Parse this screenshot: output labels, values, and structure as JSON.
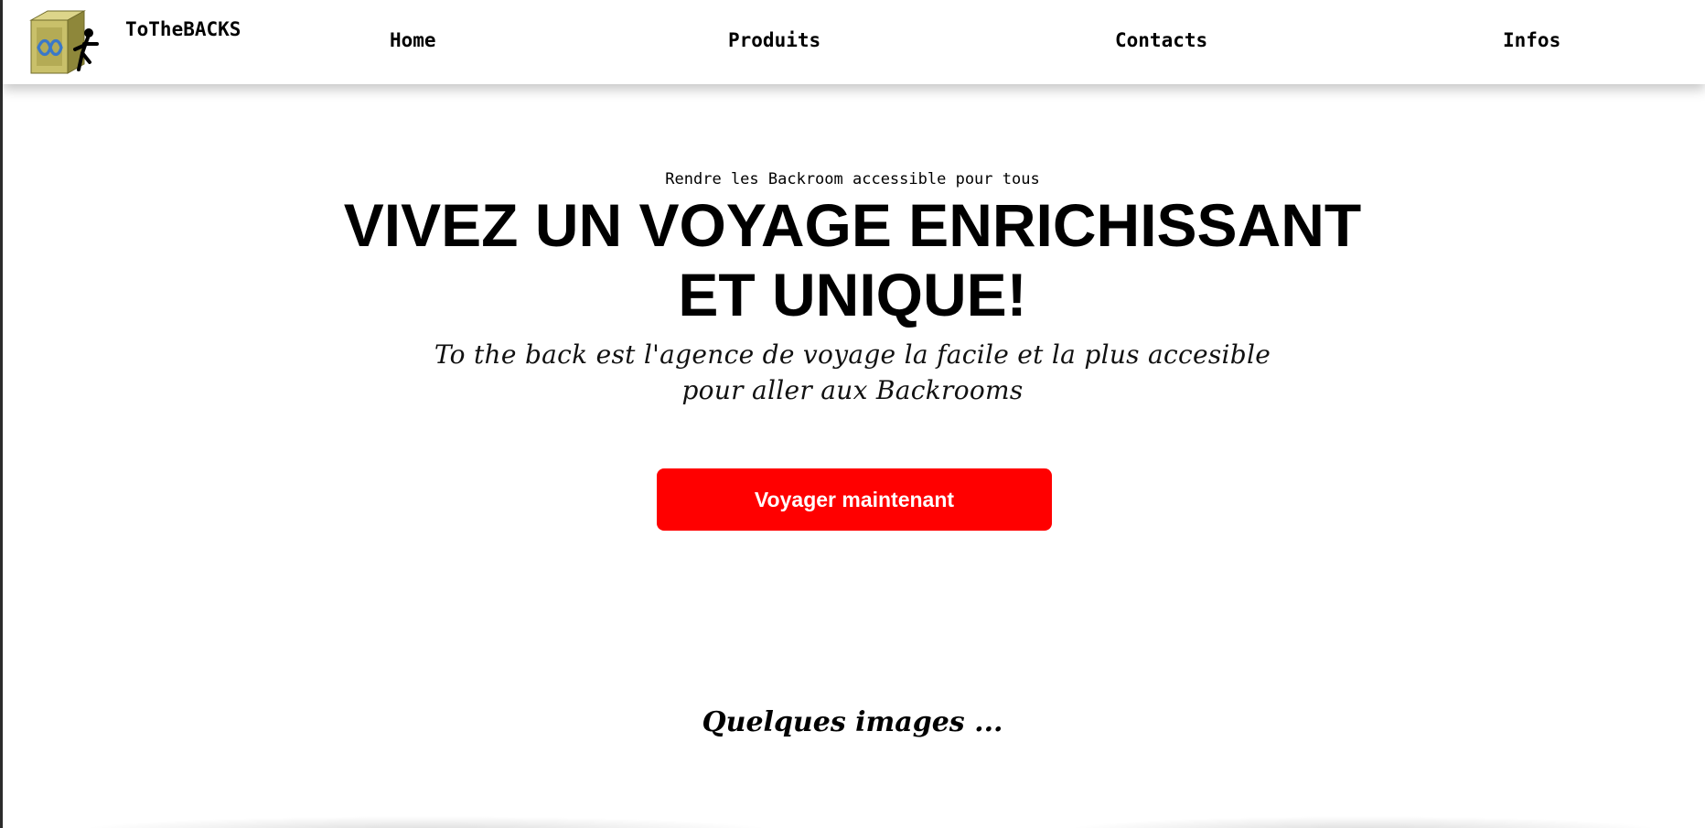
{
  "brand": {
    "name": "ToTheBACKS",
    "logo_icon": "backrooms-cube-logo-icon"
  },
  "nav": {
    "items": [
      {
        "label": "Home"
      },
      {
        "label": "Produits"
      },
      {
        "label": "Contacts"
      },
      {
        "label": "Infos"
      }
    ]
  },
  "hero": {
    "tagline": "Rendre les Backroom accessible pour tous",
    "headline": "VIVEZ UN VOYAGE ENRICHISSANT ET UNIQUE!",
    "subtext": "To the back est l'agence de voyage la facile et la plus accesible pour aller aux Backrooms",
    "cta_label": "Voyager maintenant"
  },
  "gallery": {
    "title": "Quelques images ..."
  },
  "colors": {
    "cta_background": "#ff0000",
    "cta_text": "#ffffff",
    "logo_cube": "#b5ad4c"
  }
}
